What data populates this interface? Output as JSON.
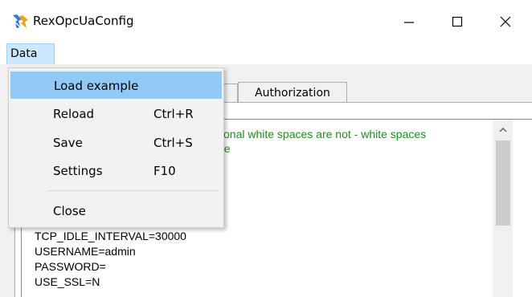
{
  "window": {
    "title": "RexOpcUaConfig",
    "icon": "rex-app-icon",
    "controls": [
      "minimize-icon",
      "maximize-icon",
      "close-icon"
    ]
  },
  "menubar": {
    "items": [
      {
        "label": "Data",
        "state": "open"
      }
    ]
  },
  "data_menu": {
    "items": [
      {
        "label": "Load example",
        "shortcut": "",
        "highlighted": true
      },
      {
        "label": "Reload",
        "shortcut": "Ctrl+R"
      },
      {
        "label": "Save",
        "shortcut": "Ctrl+S"
      },
      {
        "label": "Settings",
        "shortcut": "F10"
      },
      {
        "label": "Close",
        "shortcut": ""
      }
    ]
  },
  "tabs": [
    {
      "label": "Authorization"
    }
  ],
  "editor": {
    "comment_lines": [
      "tional white spaces are not - white spaces",
      "ue"
    ],
    "lines": [
      "TCP_IDLE_INTERVAL=30000",
      "USERNAME=admin",
      "PASSWORD=",
      "USE_SSL=N"
    ],
    "comment_color": "#1b8e1b"
  },
  "colors": {
    "menu_highlight": "#91c9f7",
    "menubar_active": "#cce8ff",
    "dialog_bg": "#f0f0f0"
  }
}
